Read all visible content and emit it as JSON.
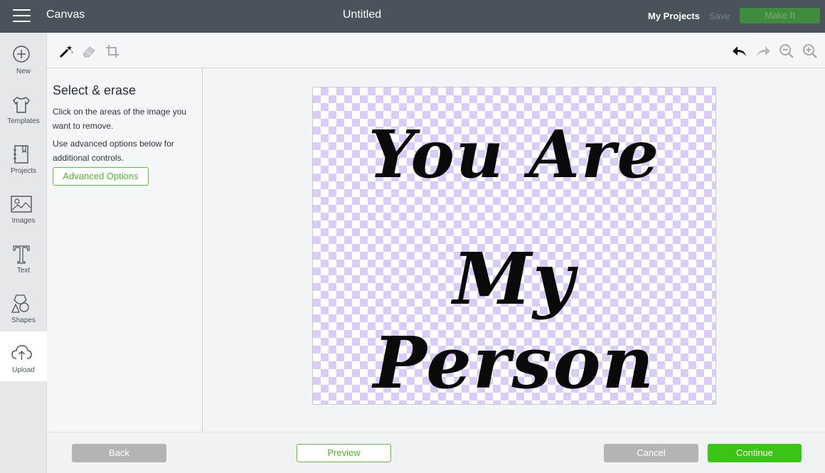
{
  "header": {
    "app_name": "Canvas",
    "doc_title": "Untitled",
    "my_projects": "My Projects",
    "save": "Save",
    "make_it": "Make It"
  },
  "sidebar": {
    "items": [
      {
        "label": "New",
        "icon": "plus-circle-icon"
      },
      {
        "label": "Templates",
        "icon": "tshirt-icon"
      },
      {
        "label": "Projects",
        "icon": "notebook-icon"
      },
      {
        "label": "Images",
        "icon": "image-icon"
      },
      {
        "label": "Text",
        "icon": "text-t-icon"
      },
      {
        "label": "Shapes",
        "icon": "shapes-icon"
      },
      {
        "label": "Upload",
        "icon": "upload-cloud-icon",
        "active": true
      }
    ]
  },
  "toolbar": {
    "left_tools": [
      "magic-wand-icon",
      "eraser-icon",
      "crop-icon"
    ],
    "right_tools": [
      "undo-icon",
      "redo-icon",
      "zoom-out-icon",
      "zoom-in-icon"
    ]
  },
  "panel": {
    "title": "Select & erase",
    "description1": "Click on the areas of the image you want to remove.",
    "description2": "Use advanced options below for additional controls.",
    "advanced_button": "Advanced Options"
  },
  "canvas": {
    "line1": "You Are",
    "line2": "My Person",
    "checker_color": "#d9ccf7"
  },
  "footer": {
    "back": "Back",
    "preview": "Preview",
    "cancel": "Cancel",
    "continue": "Continue"
  },
  "colors": {
    "topbar": "#4a535b",
    "accent_green": "#3bc415",
    "make_it_bg": "#3f8d3c"
  }
}
